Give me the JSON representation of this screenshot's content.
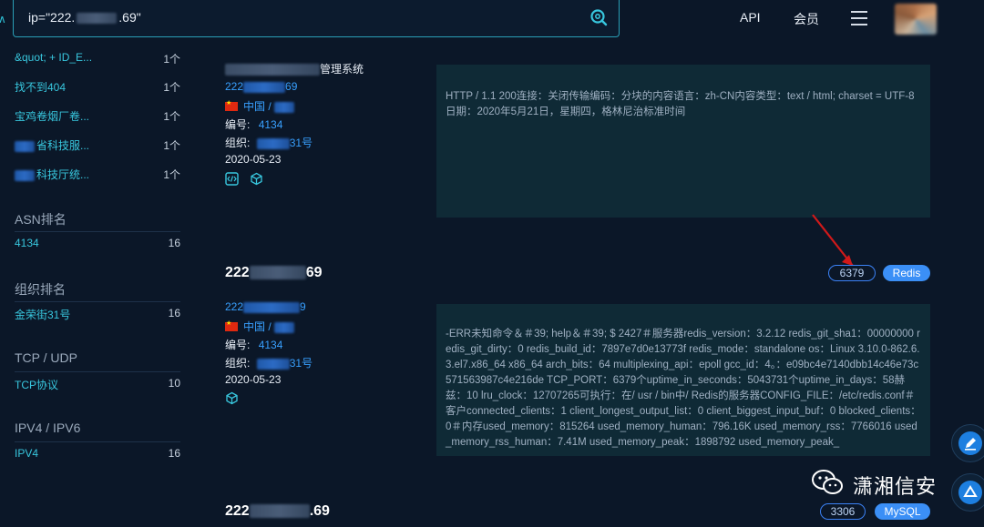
{
  "search": {
    "query_prefix": "ip=\"222.",
    "query_suffix": ".69\""
  },
  "header": {
    "api": "API",
    "member": "会员"
  },
  "sidebar": {
    "top_items": [
      {
        "label": "&quot; + ID_E...",
        "count": "1个"
      },
      {
        "label": "找不到404",
        "count": "1个"
      },
      {
        "label": "宝鸡卷烟厂卷...",
        "count": "1个"
      },
      {
        "label": "省科技服...",
        "count": "1个"
      },
      {
        "label": "科技厅统...",
        "count": "1个"
      }
    ],
    "sections": [
      {
        "title": "ASN排名",
        "item": "4134",
        "count": "16"
      },
      {
        "title": "组织排名",
        "item": "金荣街31号",
        "count": "16"
      },
      {
        "title": "TCP / UDP",
        "item": "TCP协议",
        "count": "10"
      },
      {
        "title": "IPV4 / IPV6",
        "item": "IPV4",
        "count": "16"
      }
    ]
  },
  "results": [
    {
      "title_suffix": "管理系统",
      "ip_prefix": "222",
      "ip_suffix": "69",
      "country": "中国 /",
      "asn_label": "编号:",
      "asn": "4134",
      "org_label": "组织:",
      "org_suffix": "31号",
      "date": "2020-05-23",
      "banner": "HTTP / 1.1 200连接：关闭传输编码：分块的内容语言：zh-CN内容类型：text / html; charset = UTF-8日期：2020年5月21日，星期四，格林尼治标准时间"
    },
    {
      "ip_big_prefix": "222",
      "ip_big_suffix": "69",
      "ip_prefix": "222",
      "ip_suffix": "9",
      "country": "中国 /",
      "asn_label": "编号:",
      "asn": "4134",
      "org_label": "组织:",
      "org_suffix": "31号",
      "date": "2020-05-23",
      "port": "6379",
      "service": "Redis",
      "banner": "-ERR未知命令＆＃39; help＆＃39; $ 2427＃服务器redis_version：3.2.12 redis_git_sha1：00000000 redis_git_dirty：0 redis_build_id：7897e7d0e13773f redis_mode：standalone os：Linux 3.10.0-862.6.3.el7.x86_64 x86_64 arch_bits：64 multiplexing_api：epoll gcc_id：4。：e09bc4e7140dbb14c46e73c571563987c4e216de TCP_PORT：6379个uptime_in_seconds：5043731个uptime_in_days：58赫兹：10 lru_clock：12707265可执行：在/ usr / bin中/ Redis的服务器CONFIG_FILE：/etc/redis.conf＃客户connected_clients：1 client_longest_output_list：0 client_biggest_input_buf：0 blocked_clients：0＃内存used_memory：815264 used_memory_human：796.16K used_memory_rss：7766016 used_memory_rss_human：7.41M used_memory_peak：1898792 used_memory_peak_"
    },
    {
      "ip_big_prefix": "222",
      "ip_big_suffix": ".69",
      "port": "3306",
      "service": "MySQL"
    }
  ],
  "watermark": {
    "text": "潇湘信安"
  },
  "colors": {
    "accent": "#38c7de",
    "link": "#38a0ff",
    "pill": "#3b8ff6",
    "background": "#0b1728"
  }
}
